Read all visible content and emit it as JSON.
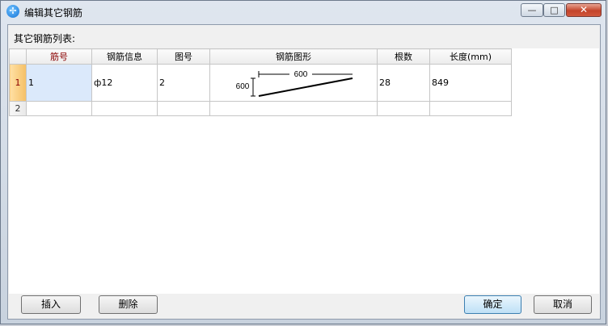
{
  "window": {
    "title": "编辑其它钢筋",
    "icon_glyph": "✢",
    "minimize_glyph": "—",
    "maximize_glyph": "□",
    "close_glyph": "✕"
  },
  "list_label": "其它钢筋列表:",
  "table": {
    "columns": [
      "筋号",
      "钢筋信息",
      "图号",
      "钢筋图形",
      "根数",
      "长度(mm)"
    ],
    "rows": [
      {
        "row_no": "1",
        "bar_no": "1",
        "rebar_info": "ф12",
        "figure_no": "2",
        "shape": {
          "horizontal": "600",
          "vertical": "600"
        },
        "count": "28",
        "length": "849"
      },
      {
        "row_no": "2",
        "bar_no": "",
        "rebar_info": "",
        "figure_no": "",
        "shape": null,
        "count": "",
        "length": ""
      }
    ]
  },
  "buttons": {
    "insert": "插入",
    "delete": "删除",
    "ok": "确定",
    "cancel": "取消"
  },
  "colors": {
    "active_header": "#f8c76a",
    "selected_cell": "#dbe9fb",
    "close_button": "#c4442b"
  }
}
